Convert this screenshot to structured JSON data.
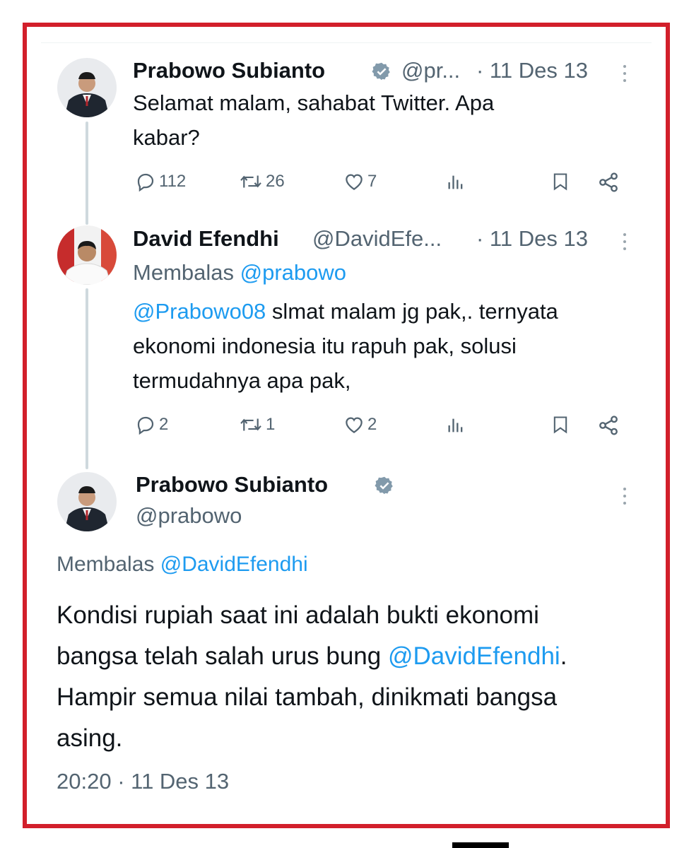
{
  "tweet1": {
    "name": "Prabowo Subianto",
    "handle": "@pr...",
    "time": "· 11 Des 13",
    "text": "Selamat malam, sahabat Twitter. Apa kabar?",
    "stats": {
      "replies": "112",
      "retweets": "26",
      "likes": "7"
    }
  },
  "tweet2": {
    "name": "David Efendhi",
    "handle": "@DavidEfe...",
    "time": "· 11 Des 13",
    "reply_label": "Membalas",
    "reply_to": "@prabowo",
    "mention": "@Prabowo08",
    "text": " slmat malam jg pak,. ternyata ekonomi indonesia itu rapuh pak, solusi termudahnya apa pak,",
    "stats": {
      "replies": "2",
      "retweets": "1",
      "likes": "2"
    }
  },
  "tweet3": {
    "name": "Prabowo Subianto",
    "handle": "@prabowo",
    "reply_label": "Membalas",
    "reply_to": "@DavidEfendhi",
    "text_before": "Kondisi rupiah saat ini adalah bukti ekonomi bangsa telah salah urus bung ",
    "mention": "@DavidEfendhi",
    "text_after": ". Hampir semua nilai tambah, dinikmati bangsa asing.",
    "timestamp": "20:20 · 11 Des 13"
  },
  "icons": {
    "reply": "reply-icon",
    "retweet": "retweet-icon",
    "like": "heart-icon",
    "views": "views-icon",
    "bookmark": "bookmark-icon",
    "share": "share-icon",
    "verified": "verified-badge-icon",
    "more": "more-icon"
  },
  "colors": {
    "frame": "#d21f2b",
    "link": "#1d9bf0",
    "text": "#0f1419",
    "muted": "#536471"
  }
}
